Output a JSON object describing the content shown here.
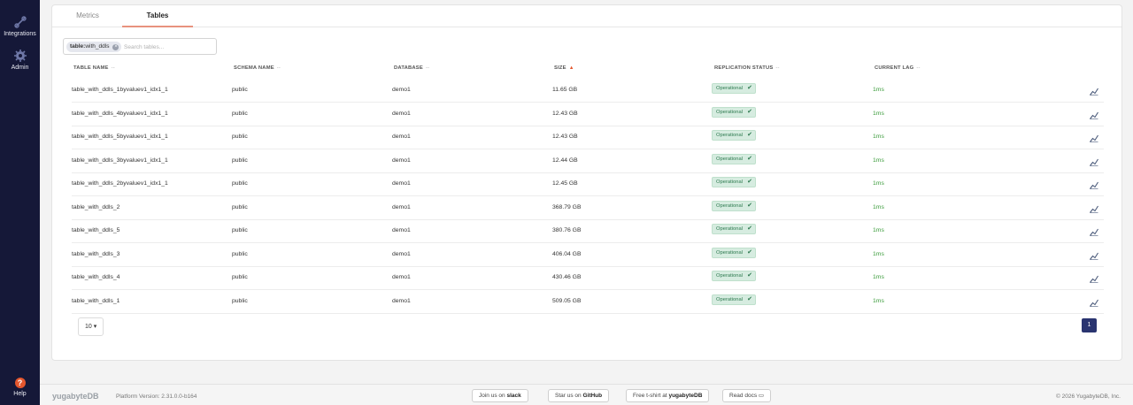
{
  "sidebar": {
    "items": [
      {
        "label": "Integrations",
        "icon": "integrations-icon"
      },
      {
        "label": "Admin",
        "icon": "gear-icon"
      }
    ],
    "help": {
      "label": "Help",
      "icon": "help-icon",
      "glyph": "?"
    }
  },
  "tabs": [
    {
      "label": "Metrics",
      "active": false
    },
    {
      "label": "Tables",
      "active": true
    }
  ],
  "search": {
    "chip_key": "table:",
    "chip_value": "with_ddls",
    "placeholder": "Search tables..."
  },
  "table": {
    "columns": [
      {
        "label": "TABLE NAME",
        "sort": "--"
      },
      {
        "label": "SCHEMA NAME",
        "sort": "--"
      },
      {
        "label": "DATABASE",
        "sort": "--"
      },
      {
        "label": "SIZE",
        "sort": "▲"
      },
      {
        "label": "REPLICATION STATUS",
        "sort": "--"
      },
      {
        "label": "CURRENT LAG",
        "sort": "--"
      }
    ],
    "rows": [
      {
        "name": "table_with_ddls_1byvaluev1_idx1_1",
        "schema": "public",
        "database": "demo1",
        "size": "11.65 GB",
        "status": "Operational",
        "lag": "1ms"
      },
      {
        "name": "table_with_ddls_4byvaluev1_idx1_1",
        "schema": "public",
        "database": "demo1",
        "size": "12.43 GB",
        "status": "Operational",
        "lag": "1ms"
      },
      {
        "name": "table_with_ddls_5byvaluev1_idx1_1",
        "schema": "public",
        "database": "demo1",
        "size": "12.43 GB",
        "status": "Operational",
        "lag": "1ms"
      },
      {
        "name": "table_with_ddls_3byvaluev1_idx1_1",
        "schema": "public",
        "database": "demo1",
        "size": "12.44 GB",
        "status": "Operational",
        "lag": "1ms"
      },
      {
        "name": "table_with_ddls_2byvaluev1_idx1_1",
        "schema": "public",
        "database": "demo1",
        "size": "12.45 GB",
        "status": "Operational",
        "lag": "1ms"
      },
      {
        "name": "table_with_ddls_2",
        "schema": "public",
        "database": "demo1",
        "size": "368.79 GB",
        "status": "Operational",
        "lag": "1ms"
      },
      {
        "name": "table_with_ddls_5",
        "schema": "public",
        "database": "demo1",
        "size": "380.76 GB",
        "status": "Operational",
        "lag": "1ms"
      },
      {
        "name": "table_with_ddls_3",
        "schema": "public",
        "database": "demo1",
        "size": "406.04 GB",
        "status": "Operational",
        "lag": "1ms"
      },
      {
        "name": "table_with_ddls_4",
        "schema": "public",
        "database": "demo1",
        "size": "430.46 GB",
        "status": "Operational",
        "lag": "1ms"
      },
      {
        "name": "table_with_ddls_1",
        "schema": "public",
        "database": "demo1",
        "size": "509.05 GB",
        "status": "Operational",
        "lag": "1ms"
      }
    ]
  },
  "pagination": {
    "page_size": "10",
    "caret": "▾",
    "current_page": "1"
  },
  "footer": {
    "logo": "yugabyteDB",
    "version": "Platform Version: 2.31.0.0-b164",
    "slack": {
      "prefix": "Join us on",
      "brand": "slack"
    },
    "github": {
      "prefix": "Star us on",
      "brand": "GitHub"
    },
    "tshirt": {
      "prefix": "Free t-shirt at",
      "brand": "yugabyteDB"
    },
    "docs": {
      "label": "Read docs"
    },
    "copyright": "© 2026 YugabyteDB, Inc."
  },
  "colors": {
    "sidebar_bg": "#151838",
    "accent": "#e8927e",
    "status_bg": "#d6ece0",
    "lag_text": "#3a9b3a",
    "page_active": "#2a3470"
  }
}
